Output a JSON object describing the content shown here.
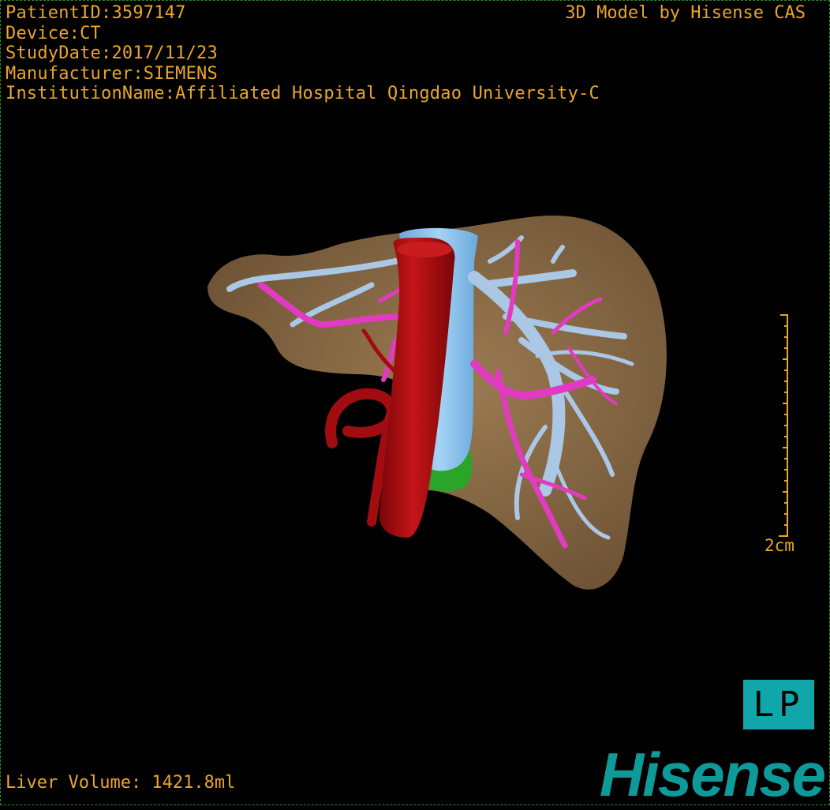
{
  "viewer": {
    "patient_id": "PatientID:3597147",
    "device": "Device:CT",
    "study_date": "StudyDate:2017/11/23",
    "manufacturer": "Manufacturer:SIEMENS",
    "institution": "InstitutionName:Affiliated Hospital Qingdao University-C",
    "model_credit": "3D Model by Hisense CAS",
    "liver_volume": "Liver Volume: 1421.8ml",
    "scale_label": "2cm",
    "orientation": "LP",
    "logo_text": "Hisense"
  },
  "colors": {
    "text": "#e8a62a",
    "liver": "#8b6b45",
    "portal_vein": "#aac8e6",
    "hepatic_vein": "#e23bc1",
    "aorta": "#b30f12",
    "ivc": "#8fc4ef",
    "green_structure": "#2aa52a",
    "brand": "#0f9a9a"
  }
}
